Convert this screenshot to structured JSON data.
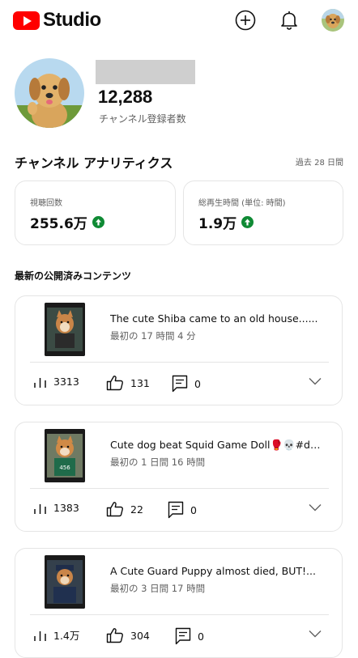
{
  "header": {
    "app_name": "Studio",
    "icons": [
      "create-icon",
      "notifications-icon",
      "account-avatar"
    ]
  },
  "channel": {
    "subscriber_count": "12,288",
    "subscriber_label": "チャンネル登録者数"
  },
  "analytics": {
    "title": "チャンネル アナリティクス",
    "period": "過去 28 日間",
    "stats": [
      {
        "label": "視聴回数",
        "value": "255.6万",
        "trend": "up"
      },
      {
        "label": "総再生時間 (単位: 時間)",
        "value": "1.9万",
        "trend": "up"
      }
    ]
  },
  "content": {
    "title": "最新の公開済みコンテンツ",
    "videos": [
      {
        "title": "The cute Shiba came to an old house......",
        "time": "最初の 17 時間 4 分",
        "views": "3313",
        "likes": "131",
        "comments": "0"
      },
      {
        "title": "Cute dog beat Squid Game Doll🥊💀#dog",
        "time": "最初の 1 日間 16 時間",
        "views": "1383",
        "likes": "22",
        "comments": "0"
      },
      {
        "title": "A Cute Guard Puppy almost died, BUT!...",
        "time": "最初の 3 日間 17 時間",
        "views": "1.4万",
        "likes": "304",
        "comments": "0"
      }
    ]
  },
  "colors": {
    "brand_red": "#ff0000",
    "trend_green": "#0f8a34"
  }
}
